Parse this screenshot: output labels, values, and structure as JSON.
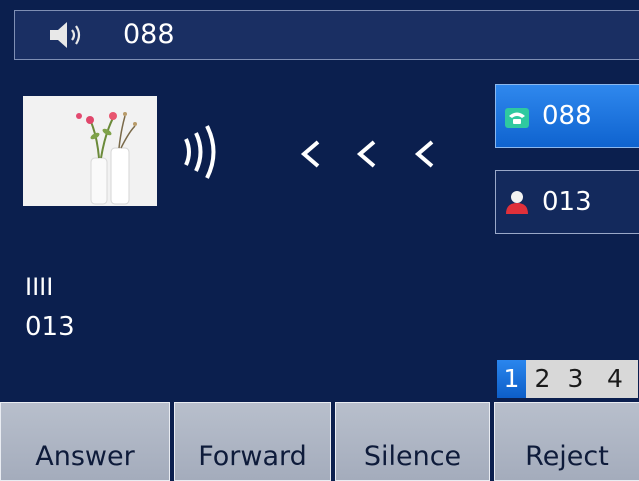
{
  "status_bar": {
    "number": "088",
    "icon": "speaker-volume-icon"
  },
  "incoming": {
    "caller_name": "IIII",
    "caller_number": "013",
    "photo_icon": "contact-photo",
    "ringing_icon": "ringing-waves-icon",
    "direction_icon": "incoming-arrows-icon"
  },
  "line_keys": [
    {
      "label": "088",
      "icon": "phone-line-icon",
      "active": true
    },
    {
      "label": "013",
      "icon": "contact-person-icon",
      "active": false
    }
  ],
  "pages": [
    "1",
    "2",
    "3",
    "4"
  ],
  "current_page": "1",
  "softkeys": {
    "answer": "Answer",
    "forward": "Forward",
    "silence": "Silence",
    "reject": "Reject"
  },
  "colors": {
    "background": "#0b1f4e",
    "active_line": "#1a72dd",
    "softkey": "#aeb5c3"
  }
}
